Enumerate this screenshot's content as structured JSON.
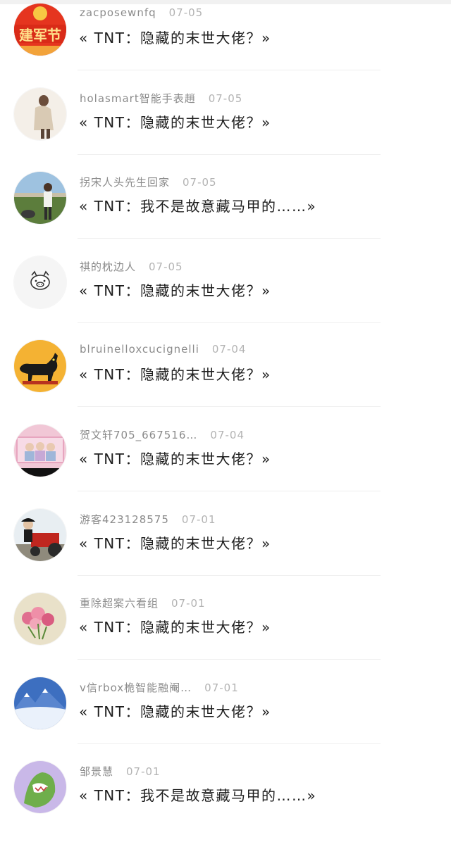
{
  "comments": [
    {
      "name": "zacposewnfq",
      "date": "07-05",
      "text": "« TNT：隐藏的末世大佬？»",
      "avatar_icon": "festival-avatar-icon",
      "avatar_text": "建军节"
    },
    {
      "name": "holasmart智能手表趙",
      "date": "07-05",
      "text": "« TNT：隐藏的末世大佬？»",
      "avatar_icon": "person-photo-avatar-icon"
    },
    {
      "name": "拐宋人头先生回家",
      "date": "07-05",
      "text": "« TNT：我不是故意藏马甲的……»",
      "avatar_icon": "outdoor-photo-avatar-icon"
    },
    {
      "name": "祺的枕边人",
      "date": "07-05",
      "text": "« TNT：隐藏的末世大佬？»",
      "avatar_icon": "pig-face-avatar-icon"
    },
    {
      "name": "blruinelloxcucignelli",
      "date": "07-04",
      "text": "« TNT：隐藏的末世大佬？»",
      "avatar_icon": "black-cat-avatar-icon"
    },
    {
      "name": "贺文轩705_667516…",
      "date": "07-04",
      "text": "« TNT：隐藏的末世大佬？»",
      "avatar_icon": "pink-photo-avatar-icon"
    },
    {
      "name": "游客423128575",
      "date": "07-01",
      "text": "« TNT：隐藏的末世大佬？»",
      "avatar_icon": "tractor-photo-avatar-icon"
    },
    {
      "name": "重除超案六看组",
      "date": "07-01",
      "text": "« TNT：隐藏的末世大佬？»",
      "avatar_icon": "flowers-avatar-icon"
    },
    {
      "name": "v信rbox桅智能融阉…",
      "date": "07-01",
      "text": "« TNT：隐藏的末世大佬？»",
      "avatar_icon": "snow-mountain-avatar-icon"
    },
    {
      "name": "邹景慧",
      "date": "07-01",
      "text": "« TNT：我不是故意藏马甲的……»",
      "avatar_icon": "cartoon-avatar-icon"
    }
  ]
}
